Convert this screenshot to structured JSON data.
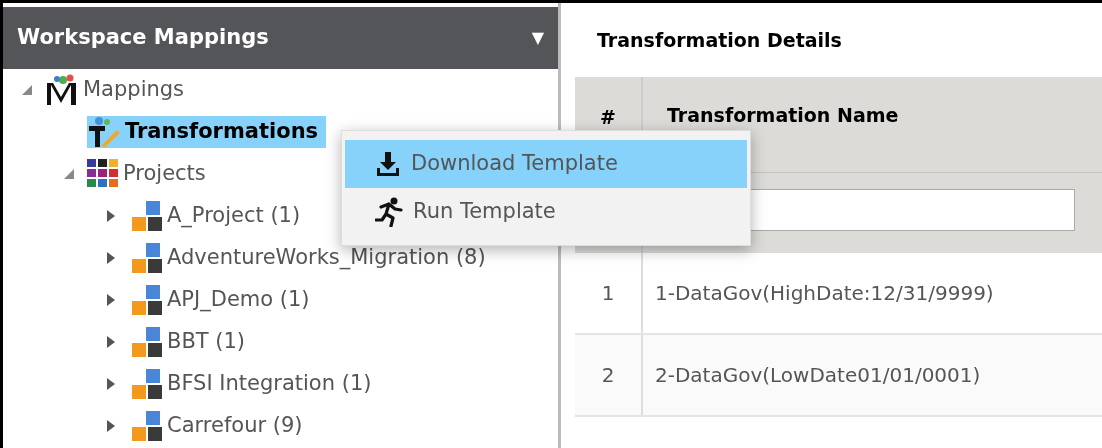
{
  "left_panel": {
    "title": "Workspace Mappings",
    "dropdown_caret": "▼",
    "tree": [
      {
        "label": "Mappings",
        "kind": "mappings",
        "expanded": true,
        "selected": false,
        "children": [
          {
            "label": "Transformations",
            "kind": "transformations",
            "selected": true
          },
          {
            "label": "Projects",
            "kind": "projects",
            "expanded": true,
            "selected": false,
            "children": [
              {
                "label": "A_Project (1)",
                "kind": "project",
                "expanded": false,
                "selected": false
              },
              {
                "label": "AdventureWorks_Migration (8)",
                "kind": "project",
                "expanded": false,
                "selected": false
              },
              {
                "label": "APJ_Demo (1)",
                "kind": "project",
                "expanded": false,
                "selected": false
              },
              {
                "label": "BBT (1)",
                "kind": "project",
                "expanded": false,
                "selected": false
              },
              {
                "label": "BFSI Integration (1)",
                "kind": "project",
                "expanded": false,
                "selected": false
              },
              {
                "label": "Carrefour (9)",
                "kind": "project",
                "expanded": false,
                "selected": false
              }
            ]
          }
        ]
      }
    ]
  },
  "context_menu": {
    "items": [
      {
        "label": "Download Template",
        "kind": "download",
        "selected": true
      },
      {
        "label": "Run Template",
        "kind": "run",
        "selected": false
      }
    ]
  },
  "details": {
    "title": "Transformation Details",
    "table": {
      "columns": [
        "#",
        "Transformation Name"
      ],
      "rows": [
        [
          "1",
          "1-DataGov(HighDate:12/31/9999)"
        ],
        [
          "2",
          "2-DataGov(LowDate01/01/0001)"
        ]
      ]
    }
  }
}
